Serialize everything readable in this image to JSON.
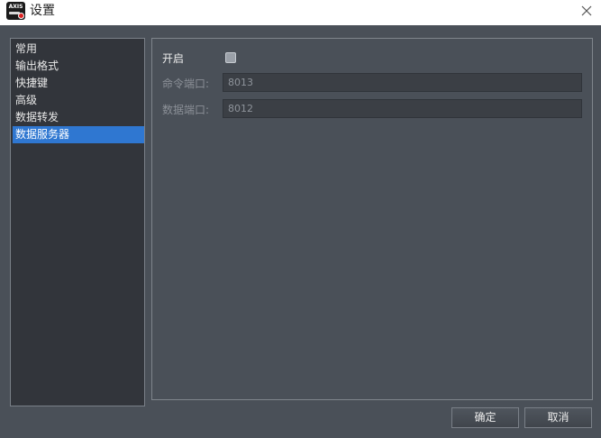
{
  "window": {
    "title": "设置",
    "icon_text": "AXIS"
  },
  "nav": {
    "items": [
      {
        "label": "常用"
      },
      {
        "label": "输出格式"
      },
      {
        "label": "快捷键"
      },
      {
        "label": "高级"
      },
      {
        "label": "数据转发"
      },
      {
        "label": "数据服务器",
        "selected": true
      }
    ]
  },
  "content": {
    "enable_label": "开启",
    "enable_checked": false,
    "command_port_label": "命令端口:",
    "command_port_value": "8013",
    "data_port_label": "数据端口:",
    "data_port_value": "8012"
  },
  "buttons": {
    "ok_label": "确定",
    "cancel_label": "取消"
  },
  "colors": {
    "background": "#4a5058",
    "nav_background": "#32353b",
    "selection": "#2f77d1",
    "field_background": "#3b3f45"
  }
}
